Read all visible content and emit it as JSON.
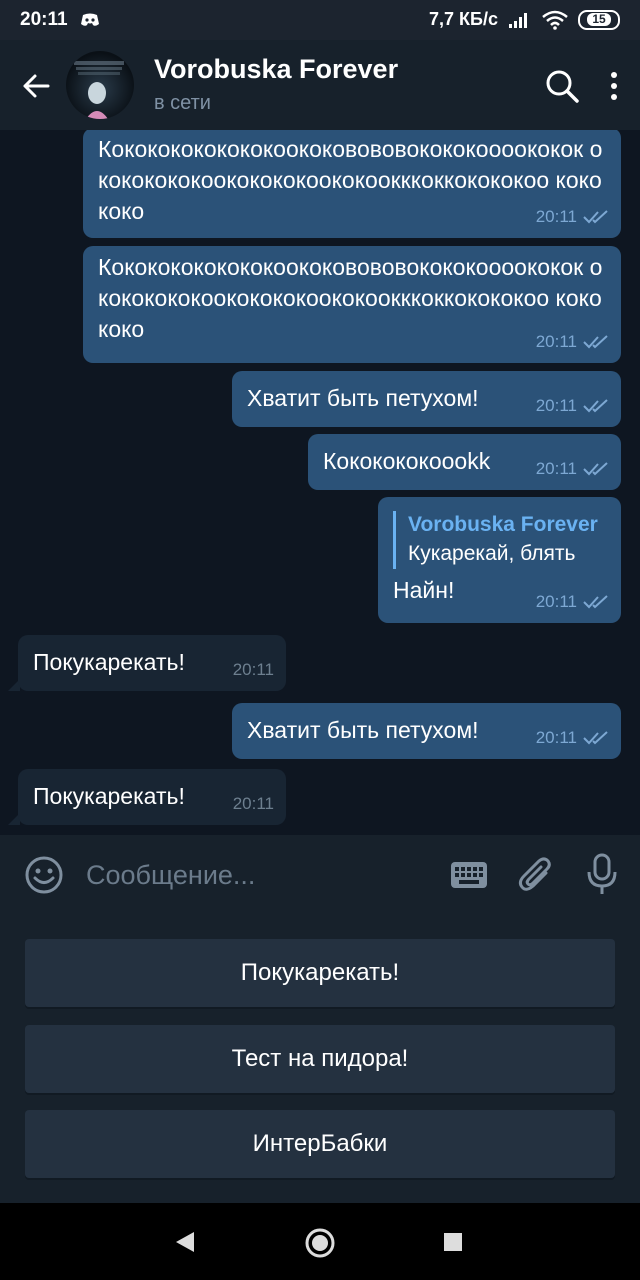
{
  "status_bar": {
    "time": "20:11",
    "speed": "7,7 КБ/с",
    "battery": "15"
  },
  "header": {
    "title": "Vorobuska Forever",
    "status": "в сети"
  },
  "messages": [
    {
      "direction": "out",
      "text": "Кокококококококоококовововокококоооококок окококококоококококоококоокккоккокококоо кокококо",
      "time": "20:11"
    },
    {
      "direction": "out",
      "text": "Кокококококококоококовововокококоооококок окококококоококококоококоокккоккокококоо кокококо",
      "time": "20:11"
    },
    {
      "direction": "out",
      "text": "Хватит быть петухом!",
      "time": "20:11"
    },
    {
      "direction": "out",
      "text": "Кококококоookk",
      "time": "20:11"
    },
    {
      "direction": "out",
      "reply_author": "Vorobuska Forever",
      "reply_text": "Кукарекай, блять",
      "text": "Найн!",
      "time": "20:11"
    },
    {
      "direction": "in",
      "text": "Покукарекать!",
      "time": "20:11"
    },
    {
      "direction": "out",
      "text": "Хватит быть петухом!",
      "time": "20:11"
    },
    {
      "direction": "in",
      "text": "Покукарекать!",
      "time": "20:11"
    }
  ],
  "input": {
    "placeholder": "Сообщение..."
  },
  "bot_keyboard": [
    "Покукарекать!",
    "Тест на пидора!",
    "ИнтерБабки"
  ],
  "colors": {
    "background": "#0e1621",
    "header": "#17212b",
    "outgoing_bubble": "#2b5278",
    "incoming_bubble": "#182533",
    "accent": "#6ab2f2"
  }
}
